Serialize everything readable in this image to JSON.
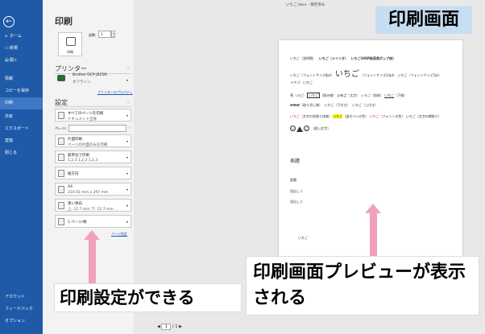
{
  "nav": {
    "back": "←",
    "items": [
      {
        "icon": "⌂",
        "label": "ホーム"
      },
      {
        "icon": "▭",
        "label": "新規"
      },
      {
        "icon": "▤",
        "label": "開く"
      },
      {
        "icon": "",
        "label": "情報"
      },
      {
        "icon": "",
        "label": "コピーを保存"
      },
      {
        "icon": "",
        "label": "印刷"
      },
      {
        "icon": "",
        "label": "共有"
      },
      {
        "icon": "",
        "label": "エクスポート"
      },
      {
        "icon": "",
        "label": "変換"
      },
      {
        "icon": "",
        "label": "閉じる"
      }
    ],
    "bottom": [
      {
        "label": "アカウント"
      },
      {
        "label": "フィードバック"
      },
      {
        "label": "オプション"
      }
    ]
  },
  "panel": {
    "title": "印刷",
    "print_button": "印刷",
    "copies_label": "部数:",
    "copies_value": "1",
    "printer_section": "プリンター",
    "printer_name": "Brother DCP-J925N",
    "printer_status": "オフライン",
    "printer_properties": "プリンターのプロパティ",
    "settings_section": "設定",
    "settings": [
      {
        "line1": "すべてのページを印刷",
        "line2": "ドキュメント全体"
      },
      {
        "line1": "片面印刷",
        "line2": "ページの片面のみを印刷"
      },
      {
        "line1": "部単位で印刷",
        "line2": "1,2,3   1,2,3   1,2,3"
      },
      {
        "line1": "縦方向",
        "line2": ""
      },
      {
        "line1": "A4",
        "line2": "210.01 mm x 297 mm"
      },
      {
        "line1": "狭い余白",
        "line2": "上: 12.7 mm 下: 12.7 mm ..."
      },
      {
        "line1": "1 ページ/枚",
        "line2": ""
      }
    ],
    "pages_label": "ページ:",
    "page_setup": "ページ設定"
  },
  "preview": {
    "doc_title": "いちご.docx - 保存済み",
    "lines": {
      "l1a": "いちご（游明朝）",
      "l1b": "いちご（メイリオ）",
      "l1c": "いちご(HGP創英角ポップ体)",
      "l2a": "いちご（フォントサイズ8pt）",
      "l2b": "いちご",
      "l2c": "（フォントサイズ24pt）",
      "l2d": "いちご（フォントサイズ7pt）",
      "l3a": "イチゴ",
      "l3b": "いちご",
      "l4a": "苺（ルビ）",
      "l4b": "いちご",
      "l4c": "（囲み線）",
      "l4d": "いちご",
      "l4e": "（太字）",
      "l4f": "いちご",
      "l4g": "（斜体）",
      "l4h": "いちご",
      "l4i": "（下線）",
      "l5a": "いちご",
      "l5b": "（取り消し線）",
      "l5c": "いちご",
      "l5d": "（下付き）",
      "l5e": "いちご",
      "l5f": "（上付き）",
      "l6a": "いちご",
      "l6b": "（文字の効果と体裁）",
      "l6c": "いちご",
      "l6d": "（蛍光ペンの色）",
      "l6e": "いちご",
      "l6f": "（フォントの色）",
      "l6g": "いちご",
      "l6h": "（文字の網掛け）",
      "l7a": "い",
      "l7b": "ち",
      "l7c": "ご",
      "l7d": "（囲い文字）",
      "heading": "表題",
      "h2": "副題",
      "h3": "見出し１",
      "h4": "見出し２",
      "foot": "いちご"
    },
    "page_current": "1",
    "page_total": "/ 1"
  },
  "annotations": {
    "screen": "印刷画面",
    "preview": "印刷画面プレビューが表示される",
    "settings": "印刷設定ができる"
  }
}
